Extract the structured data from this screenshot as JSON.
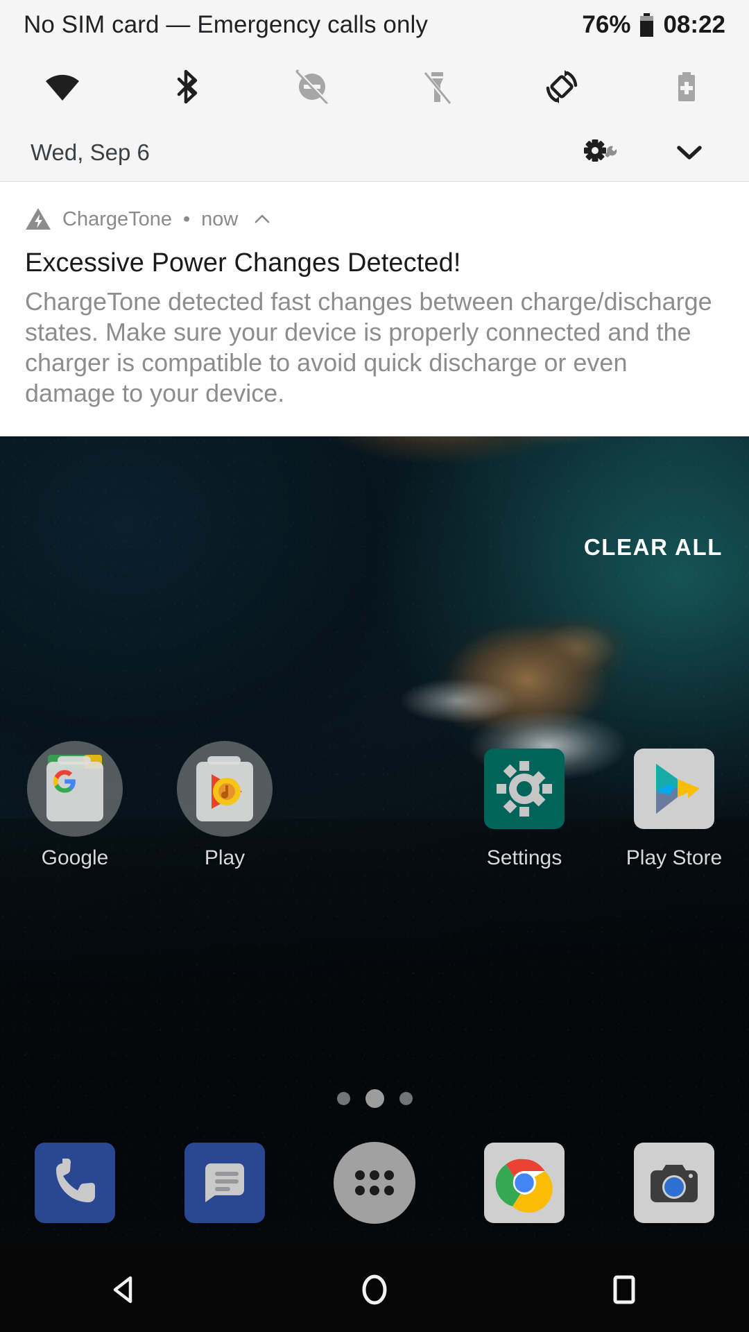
{
  "status_bar": {
    "carrier": "No SIM card — Emergency calls only",
    "battery_percent": "76%",
    "battery_icon": "battery-icon",
    "clock": "08:22"
  },
  "quick_settings": {
    "tiles": [
      {
        "name": "wifi-icon",
        "label": "Wi-Fi",
        "state": "on"
      },
      {
        "name": "bluetooth-icon",
        "label": "Bluetooth",
        "state": "on"
      },
      {
        "name": "do-not-disturb-icon",
        "label": "Do Not Disturb",
        "state": "off"
      },
      {
        "name": "flashlight-icon",
        "label": "Flashlight",
        "state": "off"
      },
      {
        "name": "auto-rotate-icon",
        "label": "Auto-rotate",
        "state": "on"
      },
      {
        "name": "battery-saver-icon",
        "label": "Battery Saver",
        "state": "off"
      }
    ]
  },
  "date_row": {
    "date": "Wed, Sep 6",
    "settings_icon": "settings-gear-icon",
    "expand_icon": "chevron-down-icon"
  },
  "notification": {
    "app_icon": "chargetone-warning-icon",
    "app_name": "ChargeTone",
    "separator": "•",
    "time": "now",
    "collapse_icon": "chevron-up-icon",
    "title": "Excessive Power Changes Detected!",
    "body": "ChargeTone detected fast changes between charge/discharge states. Make sure your device is properly connected and the charger is compatible to avoid quick discharge or even damage to your device."
  },
  "clear_all": {
    "label": "CLEAR ALL"
  },
  "home_screen": {
    "apps": [
      {
        "label": "Google",
        "icon": "google-folder-icon",
        "type": "folder"
      },
      {
        "label": "Play",
        "icon": "play-music-folder-icon",
        "type": "folder"
      },
      {
        "label": "",
        "icon": "",
        "type": "empty"
      },
      {
        "label": "Settings",
        "icon": "settings-app-icon",
        "type": "app"
      },
      {
        "label": "Play Store",
        "icon": "play-store-icon",
        "type": "app"
      }
    ],
    "page_dots": {
      "count": 3,
      "active_index": 1
    },
    "dock": [
      {
        "label": "Phone",
        "icon": "phone-icon"
      },
      {
        "label": "Messages",
        "icon": "messages-icon"
      },
      {
        "label": "All Apps",
        "icon": "all-apps-icon"
      },
      {
        "label": "Chrome",
        "icon": "chrome-icon"
      },
      {
        "label": "Camera",
        "icon": "camera-icon"
      }
    ]
  },
  "nav_bar": {
    "buttons": [
      {
        "name": "back-button",
        "icon": "back-triangle-icon"
      },
      {
        "name": "home-button",
        "icon": "home-circle-icon"
      },
      {
        "name": "recents-button",
        "icon": "recents-square-icon"
      }
    ]
  },
  "colors": {
    "shade_bg": "#f5f5f5",
    "notification_bg": "#ffffff",
    "icon_active": "#212121",
    "icon_inactive": "#9e9e9e",
    "secondary_text": "#8d8d8d",
    "settings_teal": "#00695c",
    "dock_blue": "#2e4d9b"
  }
}
